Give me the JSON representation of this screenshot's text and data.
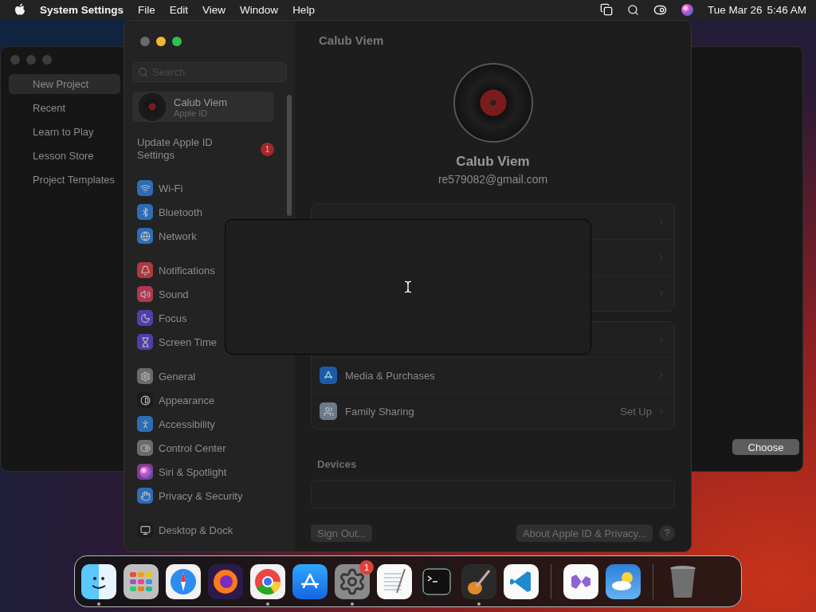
{
  "menubar": {
    "app": "System Settings",
    "menus": [
      "File",
      "Edit",
      "View",
      "Window",
      "Help"
    ],
    "date": "Tue Mar 26",
    "time": "5:46 AM"
  },
  "back_window": {
    "sidebar": [
      {
        "label": "New Project",
        "selected": true
      },
      {
        "label": "Recent",
        "selected": false
      },
      {
        "label": "Learn to Play",
        "selected": false
      },
      {
        "label": "Lesson Store",
        "selected": false
      },
      {
        "label": "Project Templates",
        "selected": false
      }
    ],
    "button": "Choose"
  },
  "settings": {
    "search": {
      "placeholder": "Search"
    },
    "account": {
      "name": "Calub Viem",
      "subtitle": "Apple ID"
    },
    "notice": {
      "label": "Update Apple ID Settings",
      "badge": "1"
    },
    "sidebar_groups": [
      [
        {
          "kind": "wifi",
          "label": "Wi-Fi",
          "color": "#2d6db5"
        },
        {
          "kind": "bluetooth",
          "label": "Bluetooth",
          "color": "#2d6db5"
        },
        {
          "kind": "network",
          "label": "Network",
          "color": "#2d6db5"
        }
      ],
      [
        {
          "kind": "notifications",
          "label": "Notifications",
          "color": "#b0383c"
        },
        {
          "kind": "sound",
          "label": "Sound",
          "color": "#b0384e"
        },
        {
          "kind": "focus",
          "label": "Focus",
          "color": "#4f3fa8"
        },
        {
          "kind": "screentime",
          "label": "Screen Time",
          "color": "#4f3fa8"
        }
      ],
      [
        {
          "kind": "general",
          "label": "General",
          "color": "#6b6b6b"
        },
        {
          "kind": "appearance",
          "label": "Appearance",
          "color": "#1c1c1c"
        },
        {
          "kind": "accessibility",
          "label": "Accessibility",
          "color": "#2d6db5"
        },
        {
          "kind": "control",
          "label": "Control Center",
          "color": "#6b6b6b"
        },
        {
          "kind": "siri",
          "label": "Siri & Spotlight",
          "color": "#7a3f8f"
        },
        {
          "kind": "privacy",
          "label": "Privacy & Security",
          "color": "#2d6db5"
        }
      ],
      [
        {
          "kind": "desktop",
          "label": "Desktop & Dock",
          "color": "#1c1c1c"
        }
      ]
    ],
    "title": "Calub Viem",
    "profile": {
      "name": "Calub Viem",
      "email": "re579082@gmail.com"
    },
    "groups": [
      [
        {
          "kind": "hidden"
        },
        {
          "kind": "hidden"
        },
        {
          "kind": "hidden"
        }
      ],
      [
        {
          "kind": "hidden"
        },
        {
          "kind": "store",
          "label": "Media & Purchases"
        },
        {
          "kind": "family",
          "label": "Family Sharing",
          "value": "Set Up"
        }
      ]
    ],
    "devices": {
      "heading": "Devices"
    },
    "buttons": {
      "sign_out": "Sign Out...",
      "about": "About Apple ID & Privacy...",
      "help": "?"
    }
  },
  "dock": [
    {
      "kind": "finder",
      "running": true
    },
    {
      "kind": "launchpad",
      "running": false
    },
    {
      "kind": "safari",
      "running": false
    },
    {
      "kind": "firefox",
      "running": false
    },
    {
      "kind": "chrome",
      "running": true
    },
    {
      "kind": "appstore",
      "running": false
    },
    {
      "kind": "settings",
      "running": true,
      "badge": "1"
    },
    {
      "kind": "textedit",
      "running": false
    },
    {
      "kind": "terminal",
      "running": false
    },
    {
      "kind": "garageband",
      "running": true
    },
    {
      "kind": "vscode",
      "running": false
    },
    {
      "kind": "divider"
    },
    {
      "kind": "studio",
      "running": false
    },
    {
      "kind": "weather",
      "running": false
    },
    {
      "kind": "divider"
    },
    {
      "kind": "trash",
      "running": false
    }
  ]
}
